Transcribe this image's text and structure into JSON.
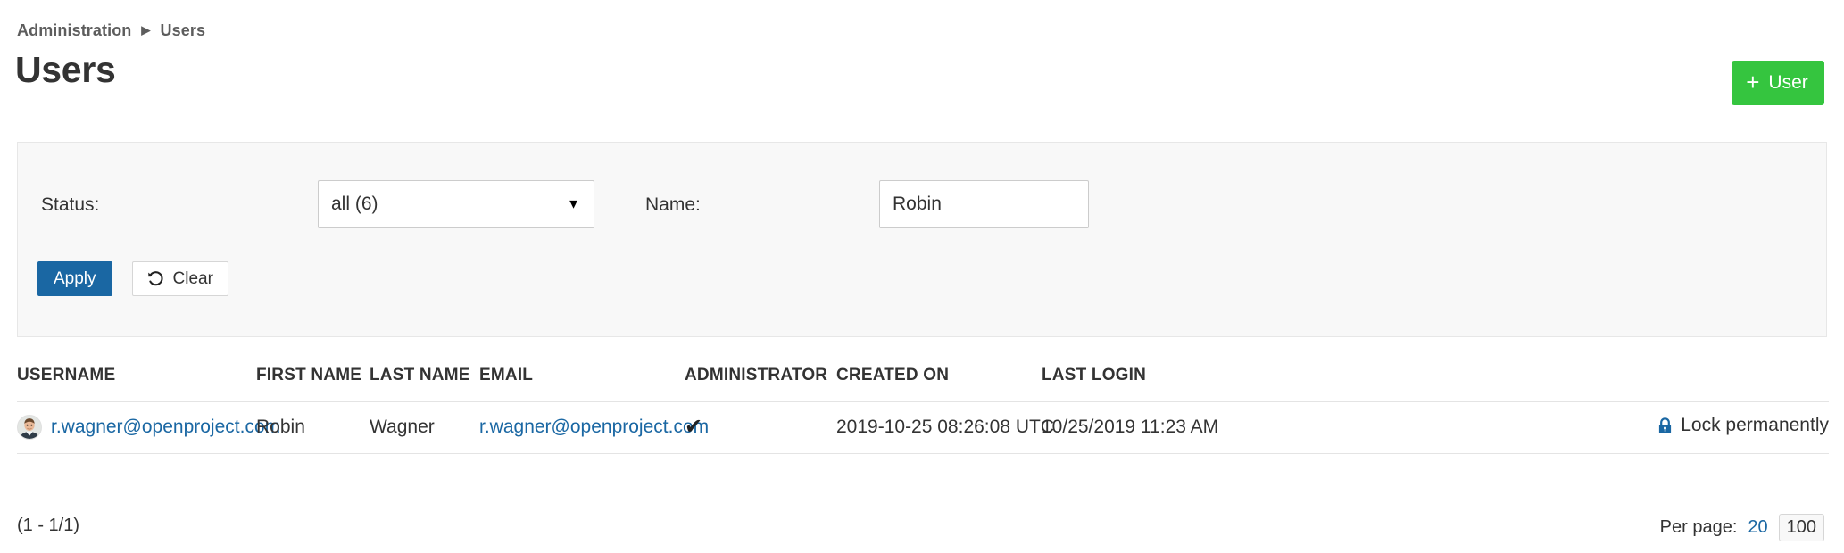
{
  "breadcrumb": {
    "items": [
      {
        "label": "Administration"
      },
      {
        "label": "Users"
      }
    ],
    "separator": "▶"
  },
  "header": {
    "title": "Users",
    "add_button": {
      "label": "User",
      "icon": "plus-icon",
      "plus": "+",
      "color": "#35c53f"
    }
  },
  "filters": {
    "status": {
      "label": "Status:",
      "selected": "all (6)",
      "caret": "▼"
    },
    "name": {
      "label": "Name:",
      "value": "Robin",
      "placeholder": ""
    },
    "apply_button": {
      "label": "Apply",
      "color": "#1a67a3"
    },
    "clear_button": {
      "label": "Clear",
      "icon": "undo-icon"
    }
  },
  "table": {
    "columns": [
      "USERNAME",
      "FIRST NAME",
      "LAST NAME",
      "EMAIL",
      "ADMINISTRATOR",
      "CREATED ON",
      "LAST LOGIN",
      ""
    ],
    "rows": [
      {
        "avatar": "user-avatar",
        "username": "r.wagner@openproject.com",
        "first_name": "Robin",
        "last_name": "Wagner",
        "email": "r.wagner@openproject.com",
        "administrator": "✔",
        "created_on": "2019-10-25 08:26:08 UTC",
        "last_login": "10/25/2019 11:23 AM",
        "action": {
          "label": "Lock permanently",
          "icon": "lock-icon",
          "icon_color": "#1a67a3"
        }
      }
    ]
  },
  "footer": {
    "range": "(1 - 1/1)",
    "per_page_label": "Per page:",
    "per_page_options": [
      {
        "value": "20",
        "active": false
      },
      {
        "value": "100",
        "active": true
      }
    ]
  }
}
